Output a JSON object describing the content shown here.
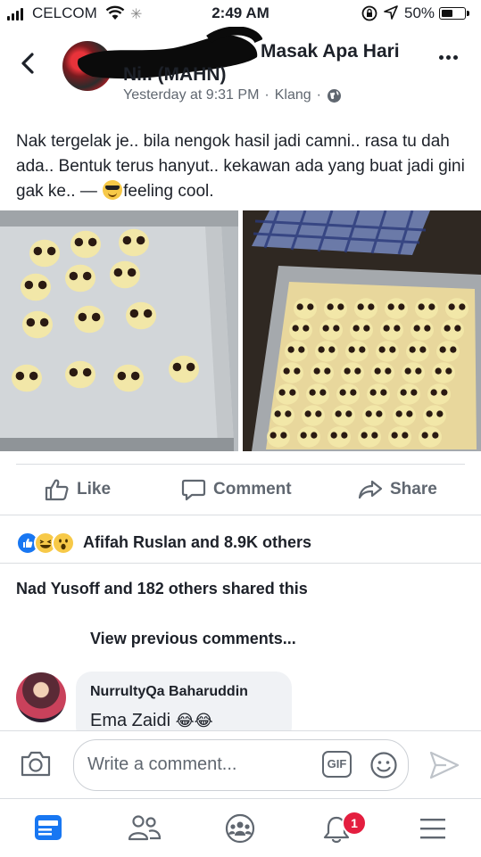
{
  "status_bar": {
    "carrier": "CELCOM",
    "time": "2:49 AM",
    "battery_percent": "50%",
    "battery_level": 0.5,
    "signal_bars": 4
  },
  "header": {
    "group_name_line1": "Masak Apa Hari",
    "group_name_line2": "Ni.. (MAHN)",
    "timestamp": "Yesterday at 9:31 PM",
    "separator": "·",
    "location": "Klang",
    "icons": [
      "back-chevron-icon",
      "globe-icon",
      "more-icon"
    ]
  },
  "post": {
    "text_before_emoji": "Nak tergelak je.. bila nengok hasil jadi camni.. rasa tu dah ada.. Bentuk terus hanyut.. kekawan ada yang buat jadi gini gak ke.. — ",
    "feeling": "feeling cool."
  },
  "actions": {
    "like": "Like",
    "comment": "Comment",
    "share": "Share"
  },
  "reactions": {
    "types": [
      "like",
      "haha",
      "wow"
    ],
    "summary": "Afifah Ruslan and 8.9K others"
  },
  "shares_summary": "Nad Yusoff and 182 others shared this",
  "view_previous": "View previous comments...",
  "comment": {
    "author": "NurrultyQa Baharuddin",
    "text": "Ema Zaidi",
    "emoji": "😂😂"
  },
  "composer": {
    "placeholder": "Write a comment...",
    "gif_label": "GIF"
  },
  "bottom_nav": {
    "notifications_badge": "1",
    "items": [
      "news-feed-icon",
      "friends-icon",
      "groups-icon",
      "notifications-icon",
      "menu-icon"
    ]
  },
  "colors": {
    "accent": "#1877f2",
    "text": "#1d2129",
    "secondary_text": "#606770",
    "badge": "#e41e3f"
  }
}
